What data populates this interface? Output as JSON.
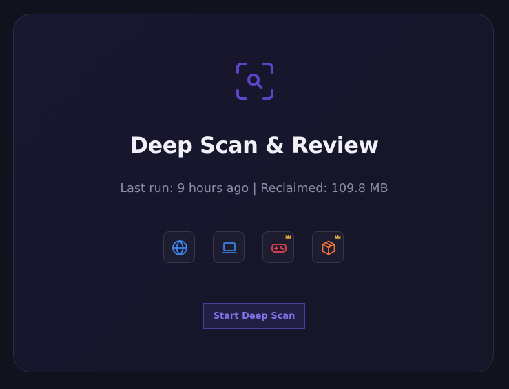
{
  "hero": {
    "icon": "scan-search-icon",
    "title": "Deep Scan & Review",
    "subtitle": "Last run: 9 hours ago | Reclaimed: 109.8 MB"
  },
  "categories": [
    {
      "icon": "globe-icon",
      "color": "#3f86f0",
      "premium": false
    },
    {
      "icon": "laptop-icon",
      "color": "#3b82e6",
      "premium": false
    },
    {
      "icon": "gamepad-icon",
      "color": "#e2454f",
      "premium": true
    },
    {
      "icon": "box-icon",
      "color": "#f0733a",
      "premium": true
    }
  ],
  "premium_badge_icon": "crown-icon",
  "colors": {
    "accent": "#5b45c8",
    "premium": "#e0a53a"
  },
  "actions": {
    "start_label": "Start Deep Scan"
  }
}
